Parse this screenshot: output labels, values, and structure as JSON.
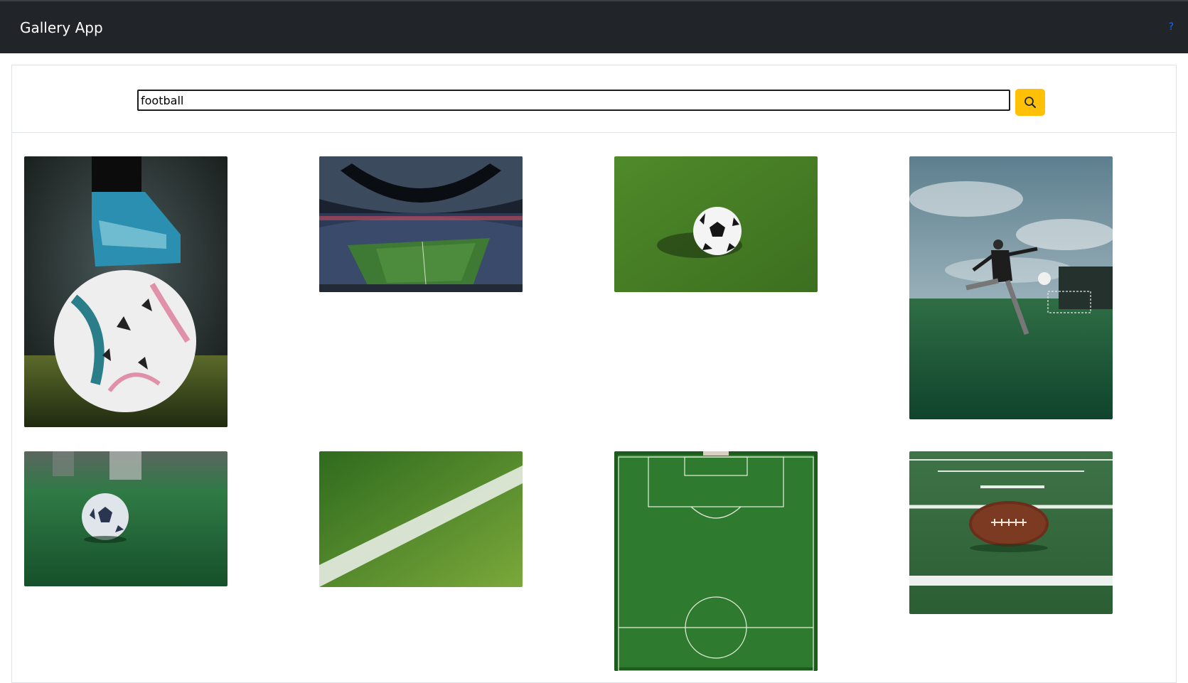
{
  "header": {
    "app_title": "Gallery App",
    "help_link": "?"
  },
  "search": {
    "query": "football",
    "button_icon": "search-icon"
  },
  "gallery": {
    "images": [
      {
        "name": "image-ball-under-boot",
        "icon": "photo"
      },
      {
        "name": "image-stadium",
        "icon": "photo"
      },
      {
        "name": "image-ball-on-grass",
        "icon": "photo"
      },
      {
        "name": "image-player-kicking",
        "icon": "photo"
      },
      {
        "name": "image-ball-on-pitch",
        "icon": "photo"
      },
      {
        "name": "image-field-line",
        "icon": "photo"
      },
      {
        "name": "image-aerial-pitch",
        "icon": "photo"
      },
      {
        "name": "image-american-football",
        "icon": "photo"
      }
    ]
  },
  "colors": {
    "navbar": "#212529",
    "accent": "#ffc107",
    "link": "#0d6efd"
  }
}
